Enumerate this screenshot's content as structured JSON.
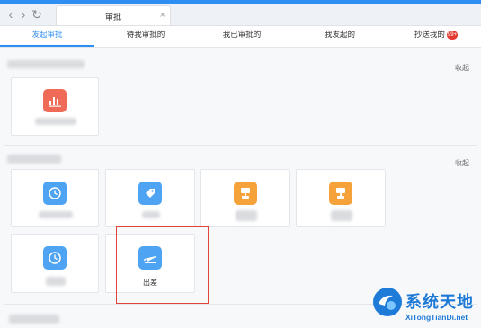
{
  "window": {
    "tab_title": "审批",
    "tab_close": "×",
    "back_glyph": "‹",
    "forward_glyph": "›",
    "refresh_glyph": "↻"
  },
  "tabs": [
    {
      "label": "发起审批",
      "active": true
    },
    {
      "label": "待我审批的",
      "active": false
    },
    {
      "label": "我已审批的",
      "active": false
    },
    {
      "label": "我发起的",
      "active": false
    },
    {
      "label": "抄送我的",
      "active": false,
      "badge": "99+"
    }
  ],
  "sections": [
    {
      "collapse_label": "收起",
      "cards": [
        {
          "icon": "chart-icon",
          "color": "#ef6a57",
          "label": ""
        }
      ]
    },
    {
      "collapse_label": "收起",
      "cards": [
        {
          "icon": "clock-icon",
          "color": "#4ea3f2",
          "label": ""
        },
        {
          "icon": "tag-icon",
          "color": "#4ea3f2",
          "label": ""
        },
        {
          "icon": "stamp-icon",
          "color": "#f5a23a",
          "label": ""
        },
        {
          "icon": "stamp-icon",
          "color": "#f5a23a",
          "label": ""
        },
        {
          "icon": "clock-icon",
          "color": "#4ea3f2",
          "label": ""
        },
        {
          "icon": "airplane-icon",
          "color": "#4ea3f2",
          "label": "出差"
        }
      ]
    }
  ],
  "watermark": {
    "title": "系统天地",
    "url": "XiTongTianDi.net"
  }
}
